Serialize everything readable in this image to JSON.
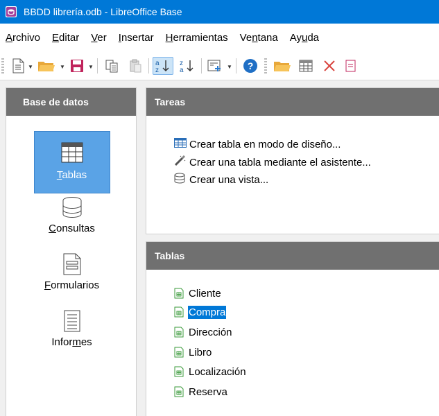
{
  "window": {
    "title": "BBDD librería.odb - LibreOffice Base",
    "app_icon": "libreoffice-base-icon"
  },
  "menu": [
    {
      "label": "Archivo"
    },
    {
      "label": "Editar"
    },
    {
      "label": "Ver"
    },
    {
      "label": "Insertar"
    },
    {
      "label": "Herramientas"
    },
    {
      "label": "Ventana"
    },
    {
      "label": "Ayuda"
    }
  ],
  "toolbar": {
    "icons": [
      "new-document-icon",
      "open-folder-icon",
      "save-icon",
      "copy-icon",
      "paste-icon",
      "sort-ascending-icon",
      "sort-descending-icon",
      "form-icon",
      "help-icon",
      "open-database-object-icon",
      "table-icon",
      "delete-icon",
      "report-icon"
    ],
    "active": "sort-ascending-icon"
  },
  "left_panel": {
    "header": "Base de datos",
    "items": [
      {
        "label": "Tablas",
        "mnemonic_index": 0,
        "icon": "table-icon",
        "selected": true
      },
      {
        "label": "Consultas",
        "mnemonic_index": 0,
        "icon": "database-query-icon",
        "selected": false
      },
      {
        "label": "Formularios",
        "mnemonic_index": 0,
        "icon": "form-document-icon",
        "selected": false
      },
      {
        "label": "Informes",
        "mnemonic_index": 5,
        "icon": "report-list-icon",
        "selected": false
      }
    ]
  },
  "tasks_panel": {
    "header": "Tareas",
    "tasks": [
      {
        "label": "Crear tabla en modo de diseño...",
        "icon": "table-design-icon"
      },
      {
        "label": "Crear una tabla mediante el asistente...",
        "icon": "wizard-wand-icon"
      },
      {
        "label": "Crear una vista...",
        "icon": "view-icon"
      }
    ]
  },
  "tables_panel": {
    "header": "Tablas",
    "rows": [
      {
        "name": "Cliente",
        "selected": false
      },
      {
        "name": "Compra",
        "selected": true
      },
      {
        "name": "Dirección",
        "selected": false
      },
      {
        "name": "Libro",
        "selected": false
      },
      {
        "name": "Localización",
        "selected": false
      },
      {
        "name": "Reserva",
        "selected": false
      }
    ]
  },
  "colors": {
    "titlebar": "#0078d7",
    "panel_header": "#707070",
    "selection": "#0078d7",
    "nav_selected": "#5aa3e6"
  }
}
